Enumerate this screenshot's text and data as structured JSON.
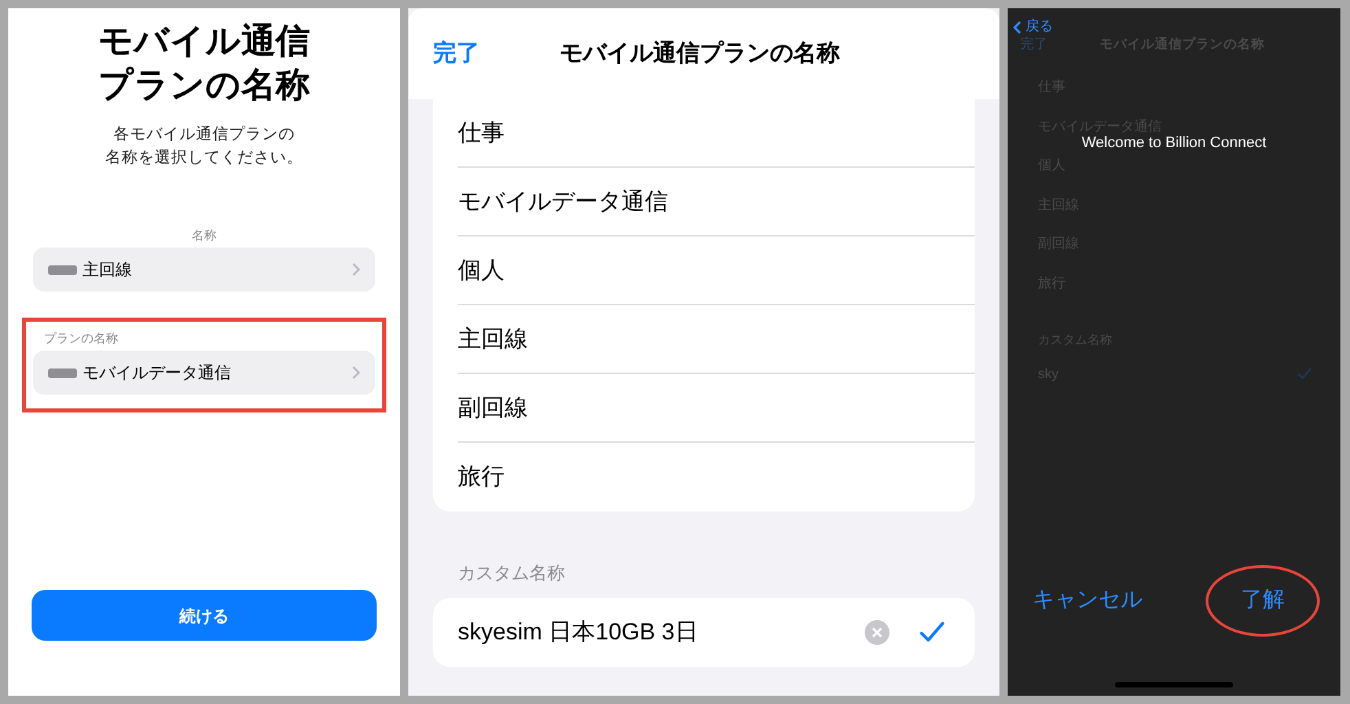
{
  "plan_setup": {
    "title_lines": [
      "モバイル通信",
      "プランの名称"
    ],
    "subtitle_lines": [
      "各モバイル通信プランの",
      "名称を選択してください。"
    ],
    "sections": [
      {
        "label": "名称",
        "value": "主回線",
        "highlighted": false
      },
      {
        "label": "プランの名称",
        "value": "モバイルデータ通信",
        "highlighted": true
      }
    ],
    "button": "続ける"
  },
  "label_picker": {
    "done": "完了",
    "title": "モバイル通信プランの名称",
    "options": [
      "仕事",
      "モバイルデータ通信",
      "個人",
      "主回線",
      "副回線",
      "旅行"
    ],
    "custom_header": "カスタム名称",
    "custom_value": "skyesim 日本10GB 3日",
    "custom_selected": true
  },
  "alert_screen": {
    "back": "戻る",
    "background": {
      "done": "完了",
      "title": "モバイル通信プランの名称",
      "options": [
        "仕事",
        "モバイルデータ通信",
        "個人",
        "主回線",
        "副回線",
        "旅行"
      ],
      "custom_header": "カスタム名称",
      "custom_value": "sky",
      "custom_selected": true
    },
    "message": "Welcome to Billion Connect",
    "buttons": [
      {
        "label": "キャンセル",
        "highlighted": false
      },
      {
        "label": "了解",
        "highlighted": true
      }
    ]
  }
}
